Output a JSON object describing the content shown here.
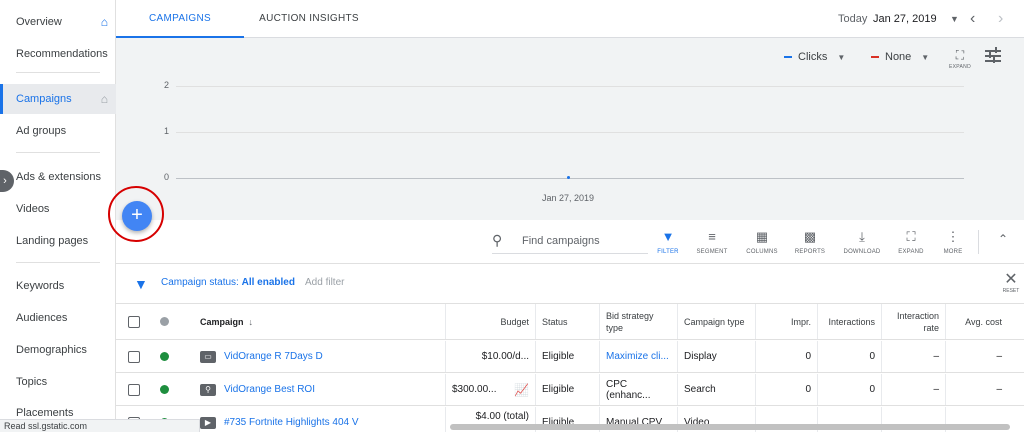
{
  "sidebar": {
    "items": [
      {
        "label": "Overview"
      },
      {
        "label": "Recommendations"
      },
      {
        "label": "Campaigns"
      },
      {
        "label": "Ad groups"
      },
      {
        "label": "Ads & extensions"
      },
      {
        "label": "Videos"
      },
      {
        "label": "Landing pages"
      },
      {
        "label": "Keywords"
      },
      {
        "label": "Audiences"
      },
      {
        "label": "Demographics"
      },
      {
        "label": "Topics"
      },
      {
        "label": "Placements"
      }
    ]
  },
  "tabs": [
    {
      "label": "CAMPAIGNS"
    },
    {
      "label": "AUCTION INSIGHTS"
    }
  ],
  "date": {
    "prefix": "Today",
    "value": "Jan 27, 2019"
  },
  "chart": {
    "metric1": "Clicks",
    "metric2": "None",
    "expand_label": "EXPAND",
    "metric1_color": "#1a73e8",
    "metric2_color": "#d93025"
  },
  "chart_data": {
    "type": "line",
    "x": [
      "Jan 27, 2019"
    ],
    "series": [
      {
        "name": "Clicks",
        "values": [
          0
        ]
      }
    ],
    "yticks": [
      "0",
      "1",
      "2"
    ],
    "ylim": [
      0,
      2
    ],
    "grid": true
  },
  "toolbar": {
    "search_placeholder": "Find campaigns",
    "tools": [
      {
        "label": "FILTER"
      },
      {
        "label": "SEGMENT"
      },
      {
        "label": "COLUMNS"
      },
      {
        "label": "REPORTS"
      },
      {
        "label": "DOWNLOAD"
      },
      {
        "label": "EXPAND"
      },
      {
        "label": "MORE"
      }
    ]
  },
  "filter": {
    "prefix": "Campaign status:",
    "value": "All enabled",
    "add": "Add filter",
    "reset": "RESET"
  },
  "table": {
    "headers": {
      "campaign": "Campaign",
      "budget": "Budget",
      "status": "Status",
      "bid_strategy": "Bid strategy type",
      "campaign_type": "Campaign type",
      "impr": "Impr.",
      "interactions": "Interactions",
      "interaction_rate": "Interaction rate",
      "avg_cost": "Avg. cost"
    },
    "rows": [
      {
        "name": "VidOrange R 7Days D",
        "budget": "$10.00/d...",
        "status": "Eligible",
        "bid": "Maximize cli...",
        "type": "Display",
        "impr": "0",
        "interactions": "0",
        "rate": "–",
        "cost": "–"
      },
      {
        "name": "VidOrange Best ROI",
        "budget": "$300.00...",
        "status": "Eligible",
        "bid": "CPC (enhanc...",
        "type": "Search",
        "impr": "0",
        "interactions": "0",
        "rate": "–",
        "cost": "–"
      },
      {
        "name": "#735 Fortnite Highlights 404 V",
        "budget": "$4.00 (total)",
        "status": "Eligible",
        "bid": "Manual CPV",
        "type": "Video",
        "impr": "",
        "interactions": "",
        "rate": "",
        "cost": ""
      }
    ]
  },
  "statusbar": "Read ssl.gstatic.com"
}
